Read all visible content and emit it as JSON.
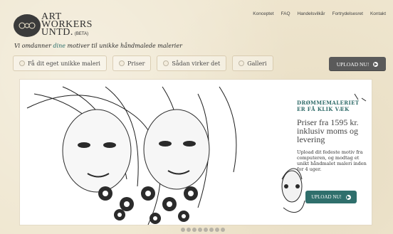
{
  "brand": {
    "line1": "ART",
    "line2": "WORKERS",
    "line3": "UNTD.",
    "beta": "(BETA)"
  },
  "topnav": [
    "Konceptet",
    "FAQ",
    "Handelsvilkår",
    "Fortrydelsesret",
    "Kontakt"
  ],
  "tagline": {
    "pre": "Vi omdanner ",
    "highlight": "dine",
    "post": " motiver til unikke håndmalede malerier"
  },
  "pillnav": [
    "Få dit eget unikke maleri",
    "Priser",
    "Sådan virker det",
    "Galleri"
  ],
  "upload_top": "UPLOAD NU!",
  "hero": {
    "heading_line1": "DRØMMEMALERIET",
    "heading_line2": "ER FÅ KLIK VÆK",
    "price_text": "Priser fra 1595 kr. inklusiv moms og levering",
    "description": "Upload dit fedeste motiv fra computeren, og modtag et unikt håndmalet maleri inden for 4 uger.",
    "button_label": "UPLOAD NU!"
  },
  "pager": {
    "count": 8,
    "active_index": 0
  }
}
